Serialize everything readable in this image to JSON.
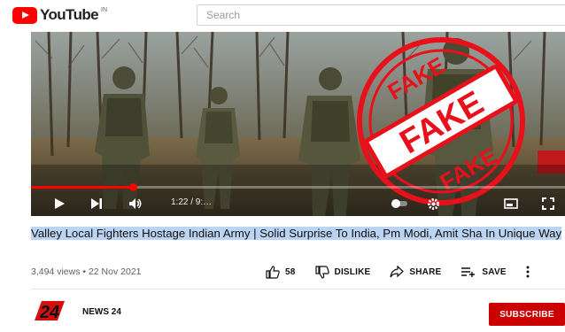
{
  "header": {
    "logo_text": "YouTube",
    "logo_region": "IN",
    "search_placeholder": "Search"
  },
  "player": {
    "time_label": "1:22 / 9:…",
    "progress": 0.19,
    "stamp_words": [
      "FAKE",
      "FAKE",
      "FAKE"
    ],
    "brand_color": "#ff0000"
  },
  "video": {
    "title": "Valley Local Fighters Hostage Indian Army | Solid Surprise To India, Pm Modi, Amit Sha In Unique Way",
    "meta": "3,494 views • 22 Nov 2021",
    "like_count": "58",
    "dislike_label": "DISLIKE",
    "share_label": "SHARE",
    "save_label": "SAVE"
  },
  "channel": {
    "logo_text": "24",
    "name": "NEWS 24",
    "subscribe_label": "SUBSCRIBE"
  }
}
